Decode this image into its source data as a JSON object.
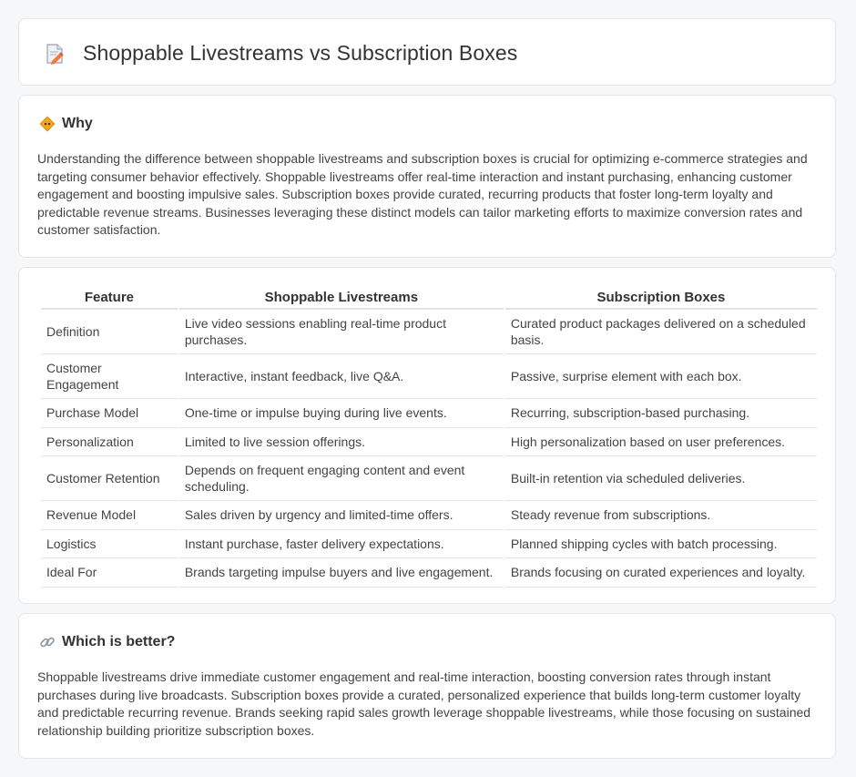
{
  "header": {
    "title": "Shoppable Livestreams vs Subscription Boxes"
  },
  "why": {
    "title": "Why",
    "text": "Understanding the difference between shoppable livestreams and subscription boxes is crucial for optimizing e-commerce strategies and targeting consumer behavior effectively. Shoppable livestreams offer real-time interaction and instant purchasing, enhancing customer engagement and boosting impulsive sales. Subscription boxes provide curated, recurring products that foster long-term loyalty and predictable revenue streams. Businesses leveraging these distinct models can tailor marketing efforts to maximize conversion rates and customer satisfaction."
  },
  "table": {
    "headers": [
      "Feature",
      "Shoppable Livestreams",
      "Subscription Boxes"
    ],
    "rows": [
      [
        "Definition",
        "Live video sessions enabling real-time product purchases.",
        "Curated product packages delivered on a scheduled basis."
      ],
      [
        "Customer Engagement",
        "Interactive, instant feedback, live Q&A.",
        "Passive, surprise element with each box."
      ],
      [
        "Purchase Model",
        "One-time or impulse buying during live events.",
        "Recurring, subscription-based purchasing."
      ],
      [
        "Personalization",
        "Limited to live session offerings.",
        "High personalization based on user preferences."
      ],
      [
        "Customer Retention",
        "Depends on frequent engaging content and event scheduling.",
        "Built-in retention via scheduled deliveries."
      ],
      [
        "Revenue Model",
        "Sales driven by urgency and limited-time offers.",
        "Steady revenue from subscriptions."
      ],
      [
        "Logistics",
        "Instant purchase, faster delivery expectations.",
        "Planned shipping cycles with batch processing."
      ],
      [
        "Ideal For",
        "Brands targeting impulse buyers and live engagement.",
        "Brands focusing on curated experiences and loyalty."
      ]
    ]
  },
  "better": {
    "title": "Which is better?",
    "text": "Shoppable livestreams drive immediate customer engagement and real-time interaction, boosting conversion rates through instant purchases during live broadcasts. Subscription boxes provide a curated, personalized experience that builds long-term customer loyalty and predictable recurring revenue. Brands seeking rapid sales growth leverage shoppable livestreams, while those focusing on sustained relationship building prioritize subscription boxes."
  },
  "icons": {
    "header": "document-pencil-icon",
    "why": "diamond-sign-icon",
    "better": "link-icon"
  }
}
